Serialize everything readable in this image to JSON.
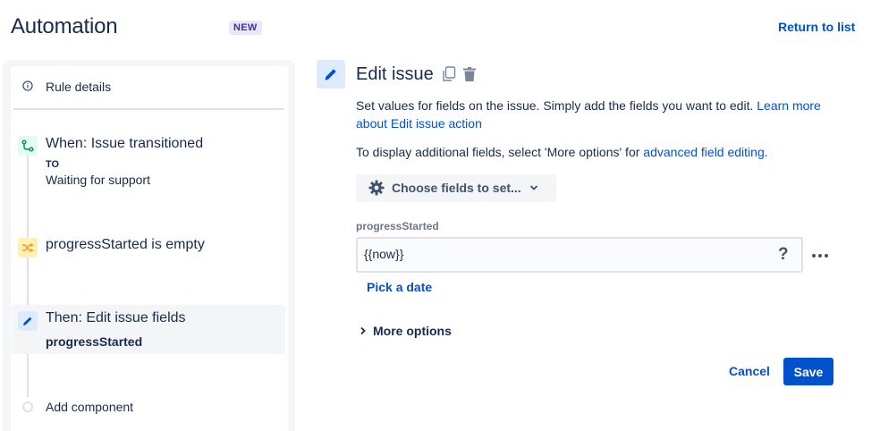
{
  "header": {
    "title": "Automation",
    "badge": "NEW",
    "return_link": "Return to list"
  },
  "sidebar": {
    "rule_details": "Rule details",
    "trigger": {
      "title": "When: Issue transitioned",
      "label": "TO",
      "value": "Waiting for support"
    },
    "condition": {
      "title": "progressStarted is empty"
    },
    "action": {
      "title": "Then: Edit issue fields",
      "field": "progressStarted"
    },
    "add_component": "Add component"
  },
  "panel": {
    "title": "Edit issue",
    "description_text": "Set values for fields on the issue. Simply add the fields you want to edit. ",
    "description_link": "Learn more about Edit issue action",
    "advanced_text": "To display additional fields, select 'More options' for ",
    "advanced_link": "advanced field editing.",
    "choose_fields": "Choose fields to set...",
    "field": {
      "label": "progressStarted",
      "value": "{{now}}",
      "help": "?"
    },
    "pick_date": "Pick a date",
    "more_options": "More options",
    "cancel": "Cancel",
    "save": "Save"
  },
  "colors": {
    "brand": "#0052cc",
    "trigger_bg": "#e3fcef",
    "trigger_icon": "#00875a",
    "condition_bg": "#fff0b3",
    "condition_icon": "#ff991f",
    "action_bg": "#deebff",
    "badge_bg": "#eae6ff"
  },
  "icons": [
    "info-icon",
    "trigger-icon",
    "condition-icon",
    "pencil-icon",
    "copy-icon",
    "trash-icon",
    "gear-icon",
    "chevron-down-icon",
    "chevron-right-icon",
    "more-icon"
  ]
}
